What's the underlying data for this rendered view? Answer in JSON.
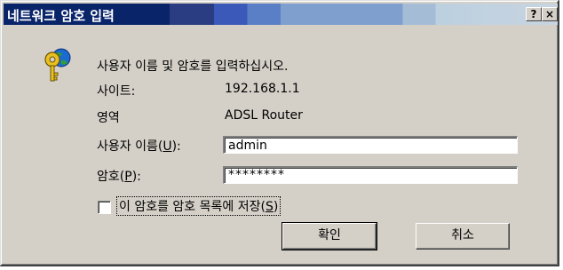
{
  "window": {
    "title": "네트워크 암호 입력",
    "help_button": "?",
    "close_button": "×"
  },
  "dialog": {
    "message": "사용자 이름 및 암호를 입력하십시오.",
    "site_label": "사이트:",
    "site_value": "192.168.1.1",
    "realm_label": "영역",
    "realm_value": "ADSL Router",
    "username_label_pre": "사용자 이름(",
    "username_label_key": "U",
    "username_label_post": "):",
    "username_value": "admin",
    "password_label_pre": "암호(",
    "password_label_key": "P",
    "password_label_post": "):",
    "password_value": "********",
    "save_password": {
      "checked": false,
      "label_pre": "이 암호를 암호 목록에 저장(",
      "label_key": "S",
      "label_post": ")"
    },
    "ok_label": "확인",
    "cancel_label": "취소"
  },
  "icons": {
    "dialog_icon": "key-globe-icon"
  },
  "colors": {
    "title_bar": "#0a246a",
    "dialog_face": "#d4d0c8"
  }
}
